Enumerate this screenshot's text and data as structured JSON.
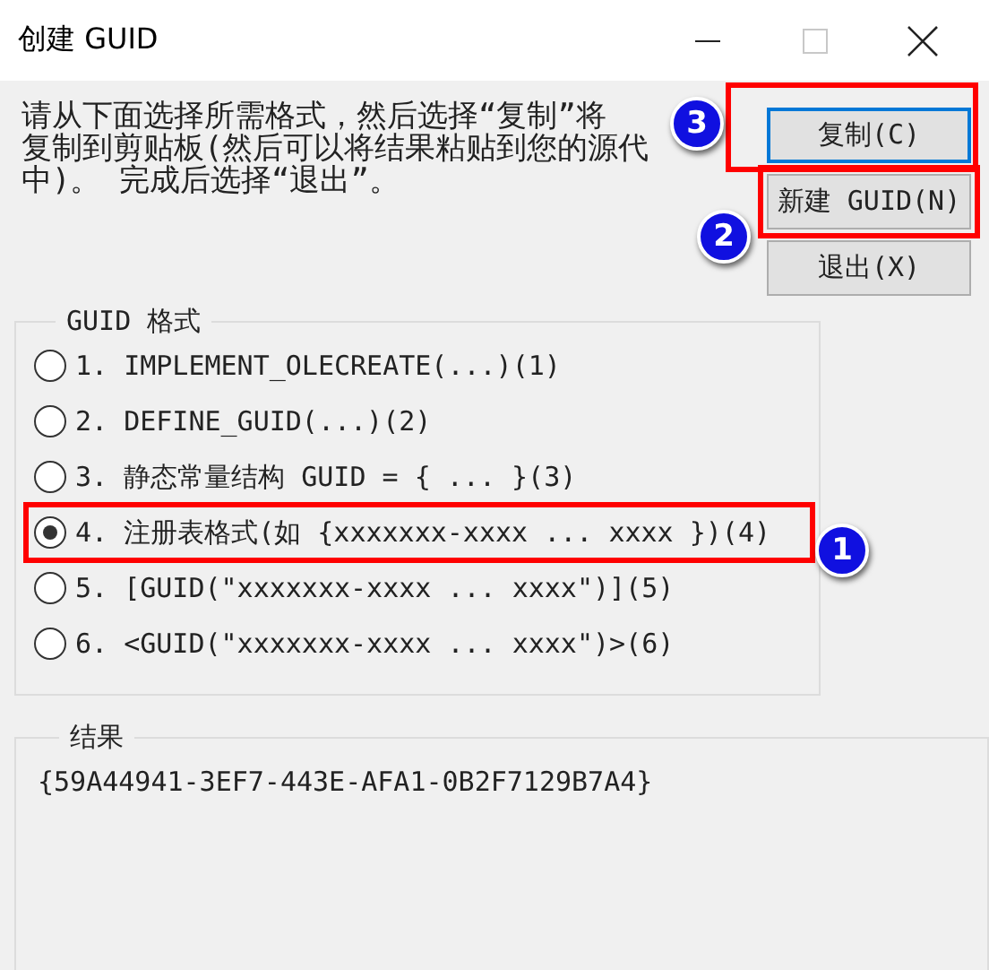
{
  "window": {
    "title": "创建 GUID",
    "controls": [
      {
        "kind": "minimize",
        "disabled": false
      },
      {
        "kind": "maximize",
        "disabled": true
      },
      {
        "kind": "close",
        "disabled": false
      }
    ]
  },
  "instructions": [
    "请从下面选择所需格式，然后选择“复制”将",
    "复制到剪贴板(然后可以将结果粘贴到您的源代",
    "中)。  完成后选择“退出”。"
  ],
  "buttons": [
    {
      "label": "复制(C)",
      "focused": true,
      "highlighted": true,
      "callout": "3"
    },
    {
      "label": "新建 GUID(N)",
      "focused": false,
      "highlighted": true,
      "callout": "2"
    },
    {
      "label": "退出(X)",
      "focused": false,
      "highlighted": false
    }
  ],
  "format_group": {
    "title": "GUID 格式",
    "options": [
      {
        "label": "1. IMPLEMENT_OLECREATE(...)(1)",
        "selected": false,
        "highlighted": false
      },
      {
        "label": "2. DEFINE_GUID(...)(2)",
        "selected": false,
        "highlighted": false
      },
      {
        "label": "3. 静态常量结构 GUID = { ... }(3)",
        "selected": false,
        "highlighted": false
      },
      {
        "label": "4. 注册表格式(如 {xxxxxxx-xxxx ... xxxx })(4)",
        "selected": true,
        "highlighted": true,
        "callout": "1"
      },
      {
        "label": "5. [GUID(\"xxxxxxx-xxxx ... xxxx\")](5)",
        "selected": false,
        "highlighted": false
      },
      {
        "label": "6. <GUID(\"xxxxxxx-xxxx ... xxxx\")>(6)",
        "selected": false,
        "highlighted": false
      }
    ]
  },
  "result_group": {
    "title": "结果",
    "value": "{59A44941-3EF7-443E-AFA1-0B2F7129B7A4}"
  }
}
